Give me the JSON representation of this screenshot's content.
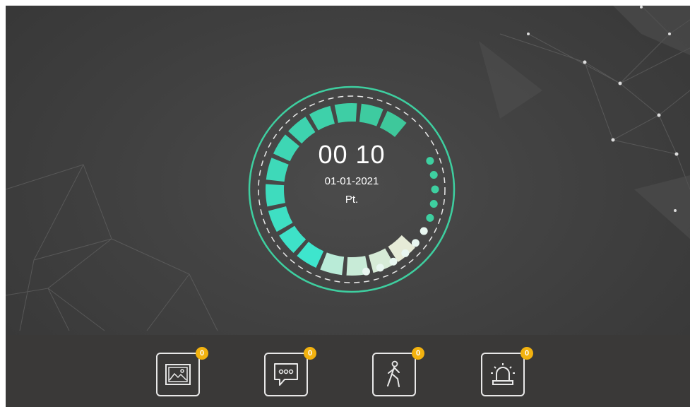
{
  "clock": {
    "time": "00 10",
    "date": "01-01-2021",
    "day": "Pt."
  },
  "toolbar": [
    {
      "name": "images-button",
      "icon": "picture-icon",
      "badge": "0"
    },
    {
      "name": "messages-button",
      "icon": "message-icon",
      "badge": "0"
    },
    {
      "name": "motion-button",
      "icon": "walking-person-icon",
      "badge": "0"
    },
    {
      "name": "alarm-button",
      "icon": "siren-icon",
      "badge": "0"
    }
  ],
  "colors": {
    "accent": "#3ecfa0",
    "badge": "#f2b20f",
    "background": "#444444",
    "bar": "#3a3938"
  }
}
